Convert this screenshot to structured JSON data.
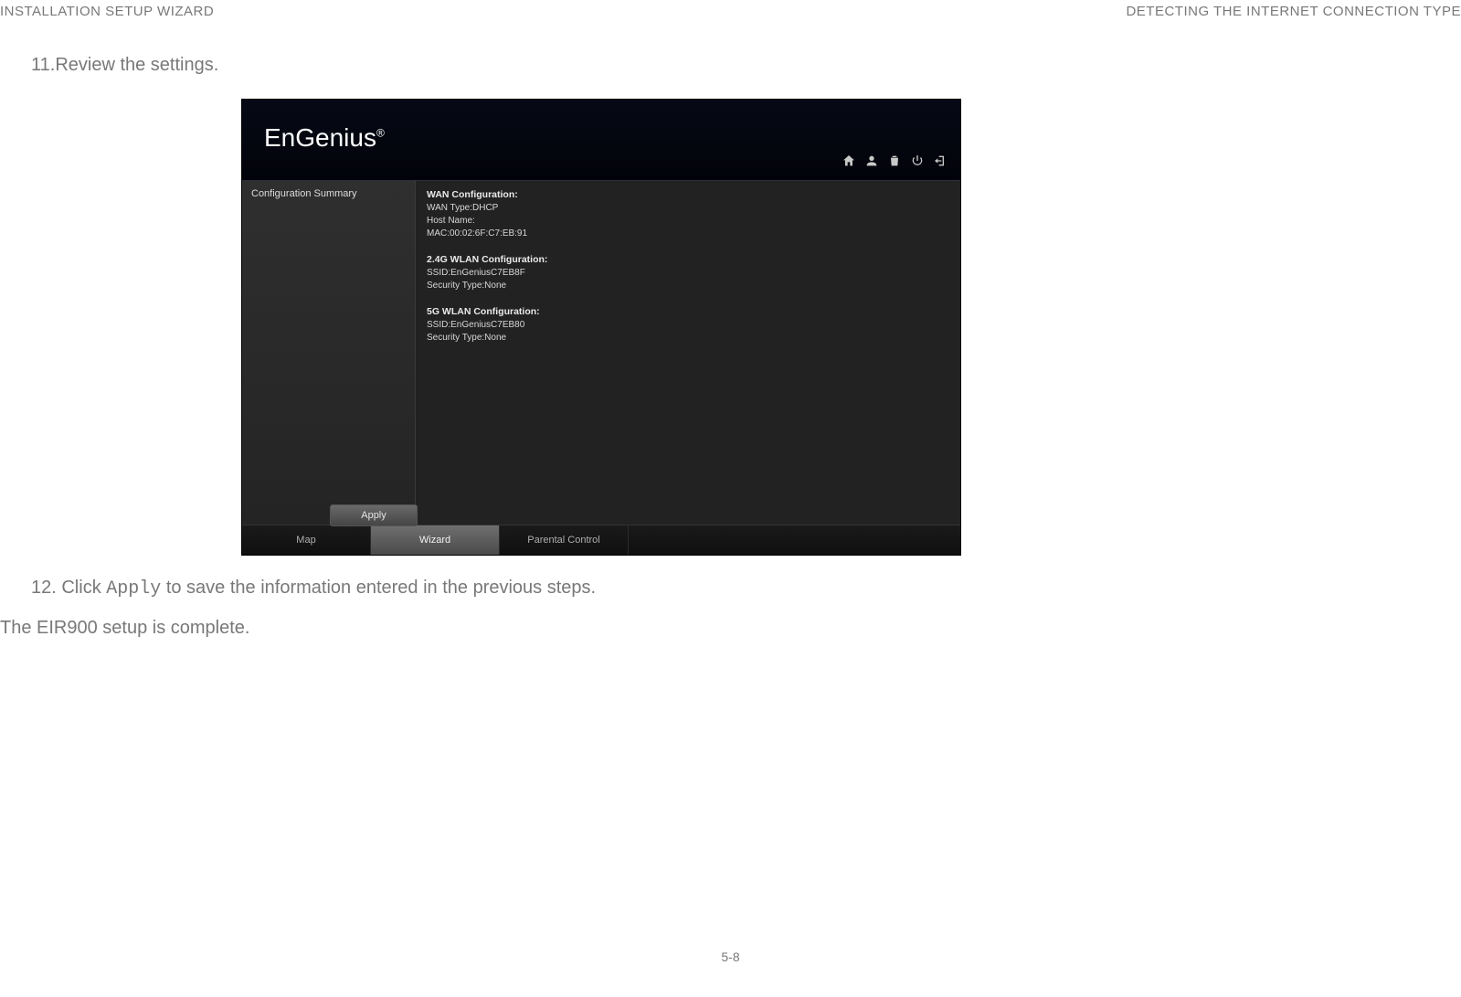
{
  "header": {
    "left": "INSTALLATION SETUP WIZARD",
    "right": "DETECTING THE INTERNET CONNECTION TYPE"
  },
  "steps": {
    "s11": "11.Review the settings.",
    "s12_prefix": "12. Click ",
    "s12_apply": "Apply",
    "s12_suffix": " to save the information entered in the previous steps."
  },
  "completion": "The EIR900 setup is complete.",
  "page_number": "5-8",
  "screenshot": {
    "logo": "EnGenius®",
    "sidebar": {
      "title": "Configuration Summary"
    },
    "content": {
      "wan_heading": "WAN Configuration:",
      "wan_type": "WAN Type:DHCP",
      "host_name": "Host Name:",
      "mac": "MAC:00:02:6F:C7:EB:91",
      "wlan24_heading": "2.4G WLAN Configuration:",
      "wlan24_ssid": "SSID:EnGeniusC7EB8F",
      "wlan24_sec": "Security Type:None",
      "wlan5_heading": "5G WLAN Configuration:",
      "wlan5_ssid": "SSID:EnGeniusC7EB80",
      "wlan5_sec": "Security Type:None"
    },
    "apply_button": "Apply",
    "tabs": {
      "map": "Map",
      "wizard": "Wizard",
      "parental": "Parental Control"
    },
    "icons": {
      "home": "home-icon",
      "user": "user-icon",
      "trash": "trash-icon",
      "power": "power-icon",
      "logout": "logout-icon"
    }
  }
}
